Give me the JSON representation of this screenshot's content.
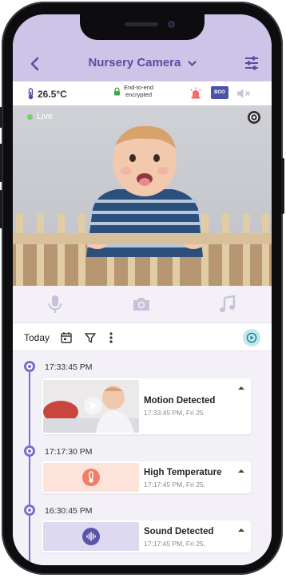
{
  "header": {
    "title": "Nursery Camera",
    "back_icon": "chevron-left-icon",
    "dropdown_icon": "chevron-down-icon",
    "settings_icon": "sliders-icon"
  },
  "status": {
    "temperature": "26.5°C",
    "encryption_line1": "End-to-end",
    "encryption_line2": "encrypted",
    "boost_label": "BOO"
  },
  "video": {
    "live_label": "Live"
  },
  "filter": {
    "today_label": "Today"
  },
  "events": [
    {
      "time": "17:33:45 PM",
      "title": "Motion Detected",
      "subtitle": "17:33:45 PM, Fri 25",
      "kind": "motion"
    },
    {
      "time": "17:17:30 PM",
      "title": "High Temperature",
      "subtitle": "17:17:45 PM, Fri 25,",
      "kind": "temperature"
    },
    {
      "time": "16:30:45 PM",
      "title": "Sound Detected",
      "subtitle": "17:17:45 PM, Fri 25,",
      "kind": "sound"
    }
  ],
  "colors": {
    "accent": "#5a4da5",
    "header_bg": "#cdc4e8",
    "timeline": "#7a6fc7",
    "live_dot": "#6fd36a",
    "temp_alert": "#f07f68",
    "sound_badge": "#5b55a8"
  }
}
